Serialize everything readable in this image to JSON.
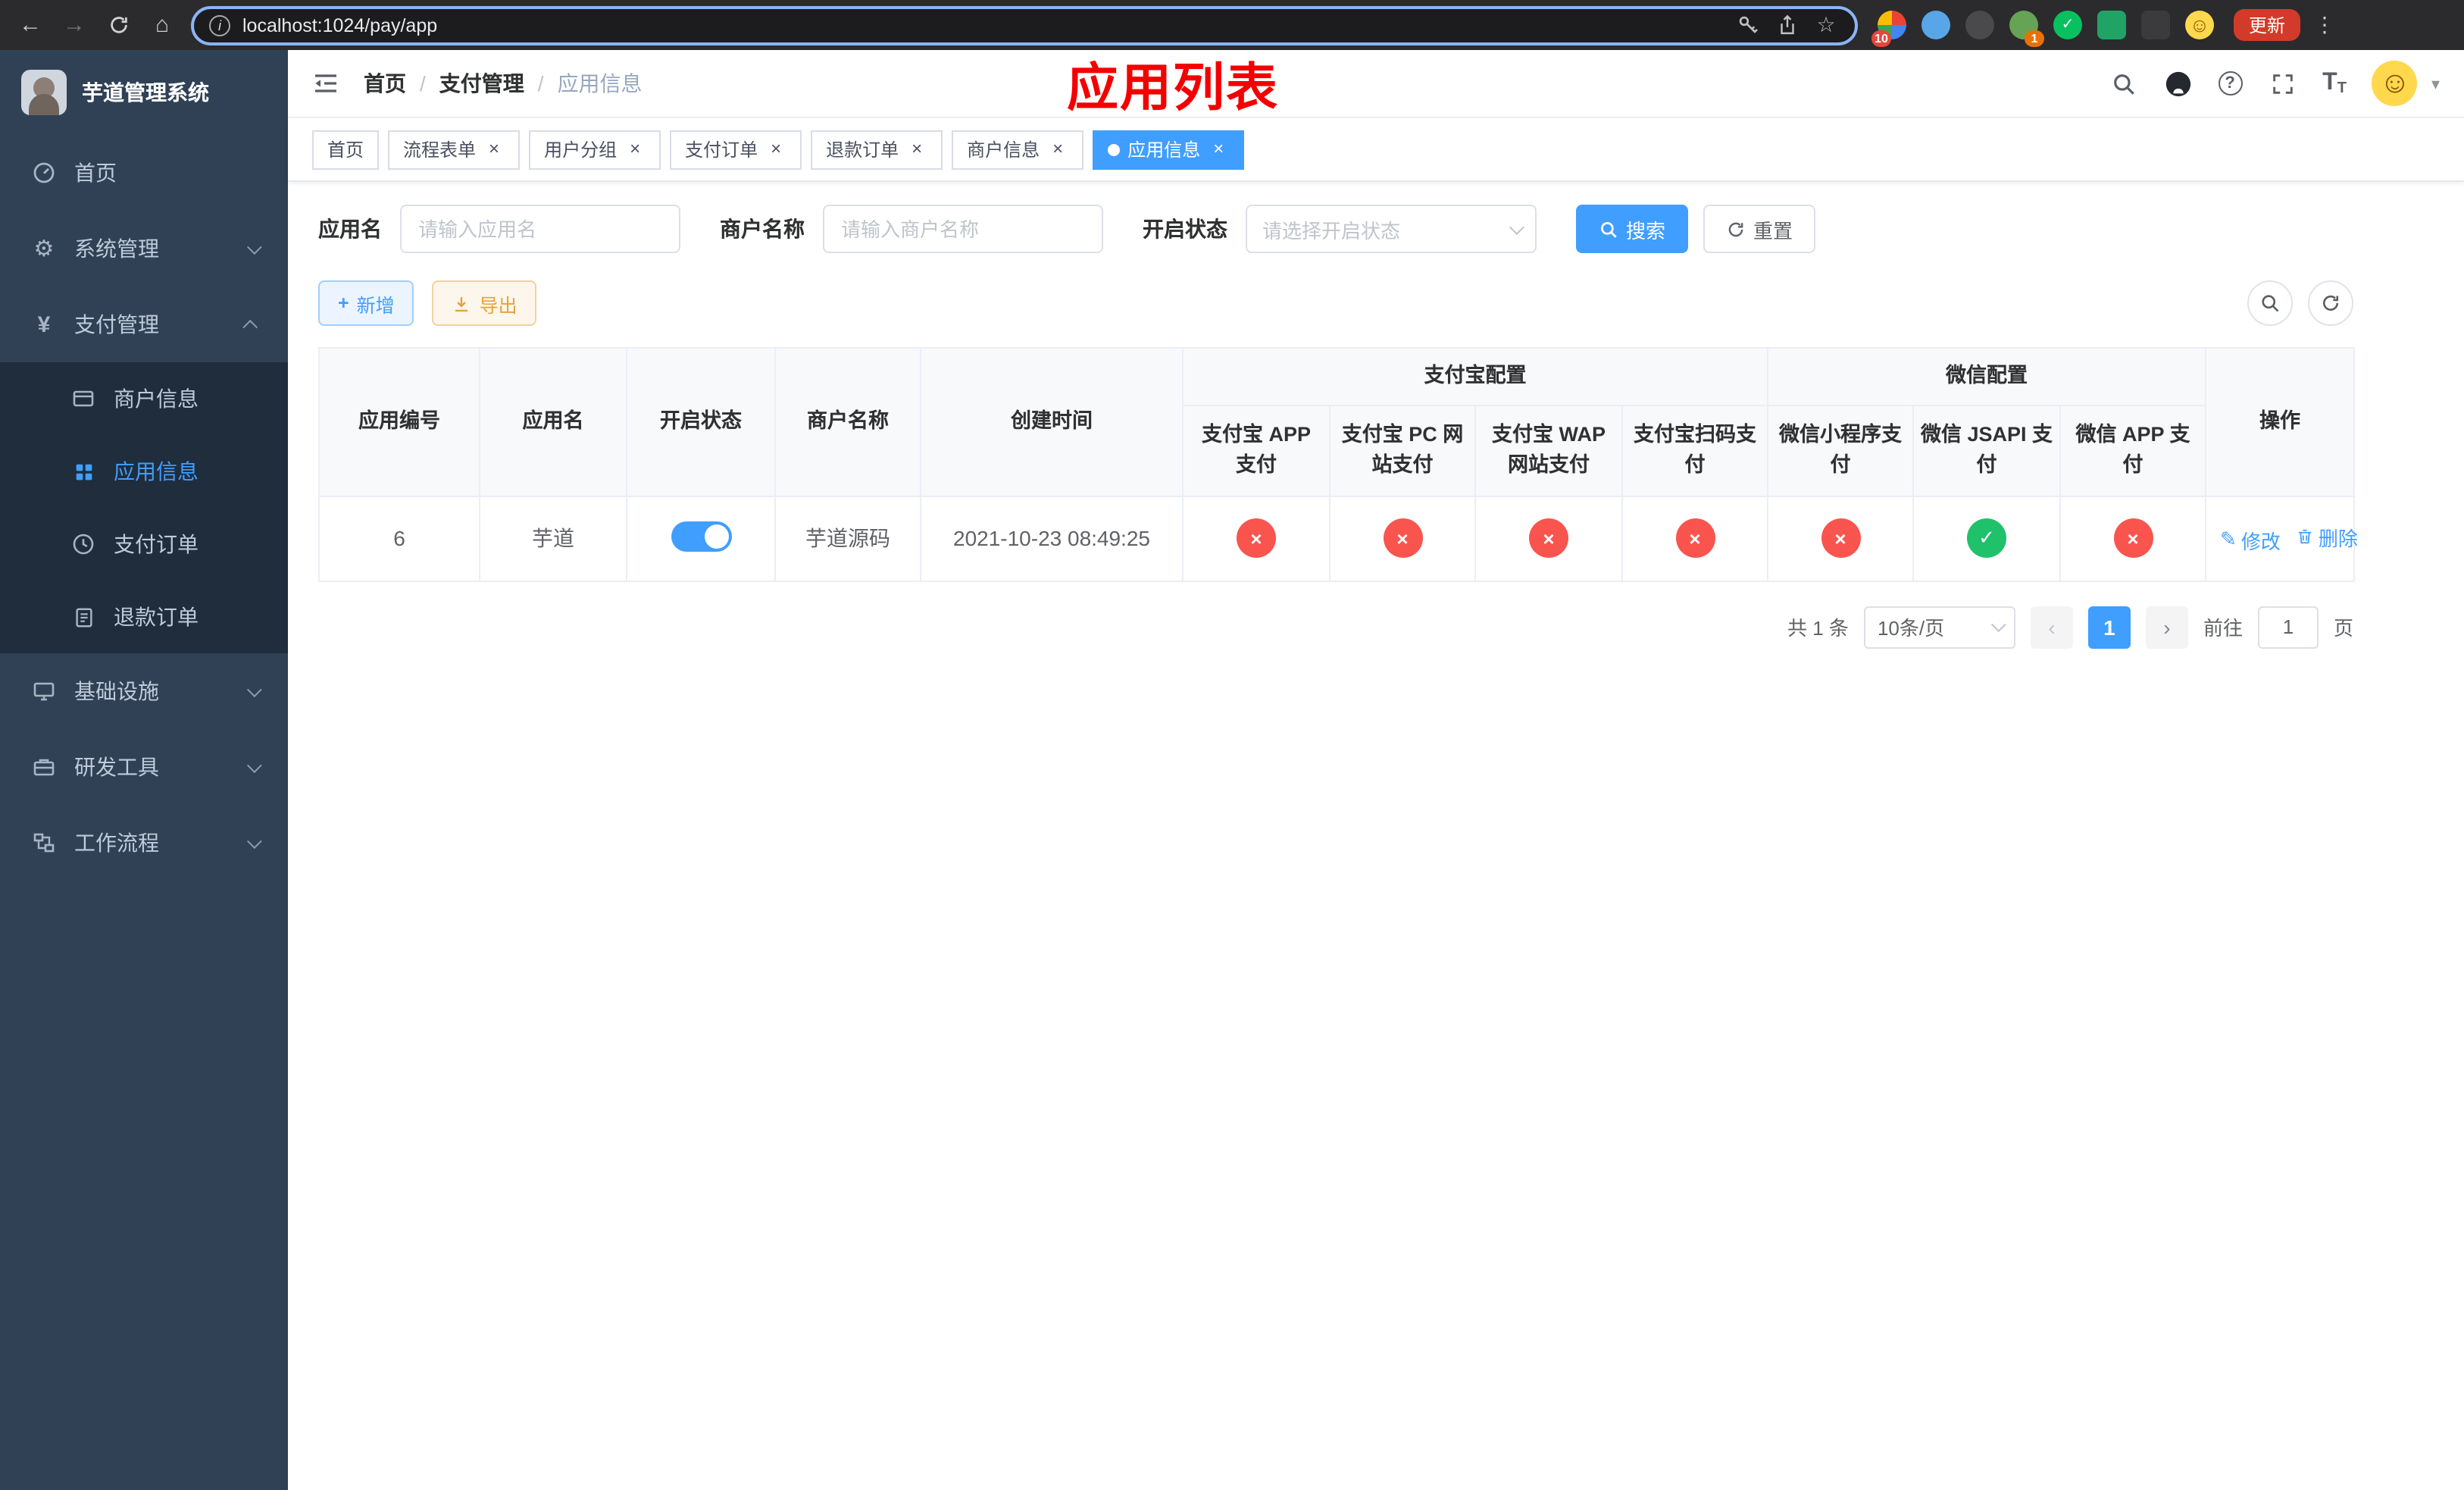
{
  "colors": {
    "accent": "#409eff",
    "success": "#1fc16b",
    "danger": "#f9544e",
    "warning": "#e6a23c",
    "sidebar_bg": "#304156",
    "submenu_bg": "#1f2d3d",
    "annotation_red": "#f50000",
    "tab_active_bg": "#409eff"
  },
  "icons": {
    "back": "←",
    "forward": "→",
    "home": "⌂",
    "info": "i",
    "star": "☆",
    "dots": "⋮",
    "gear": "⚙",
    "yen": "¥",
    "question": "?",
    "font": "T",
    "smiley": "☺",
    "caret": "▾",
    "close": "×",
    "check": "✓",
    "plus": "+",
    "edit": "✎",
    "prev": "‹",
    "next": "›"
  },
  "browser": {
    "url": "localhost:1024/pay/app",
    "update_button": "更新",
    "badge_extensions": "10",
    "badge_avatar": "1"
  },
  "sidebar": {
    "app_title": "芋道管理系统",
    "items": {
      "home": "首页",
      "system": "系统管理",
      "payment": "支付管理",
      "merchant_info": "商户信息",
      "app_info": "应用信息",
      "pay_order": "支付订单",
      "refund_order": "退款订单",
      "infrastructure": "基础设施",
      "dev_tools": "研发工具",
      "workflow": "工作流程"
    }
  },
  "header": {
    "breadcrumb": [
      "首页",
      "支付管理",
      "应用信息"
    ],
    "separator": "/",
    "annotation": "应用列表"
  },
  "tabs": [
    {
      "label": "首页",
      "closable": false,
      "active": false
    },
    {
      "label": "流程表单",
      "closable": true,
      "active": false
    },
    {
      "label": "用户分组",
      "closable": true,
      "active": false
    },
    {
      "label": "支付订单",
      "closable": true,
      "active": false
    },
    {
      "label": "退款订单",
      "closable": true,
      "active": false
    },
    {
      "label": "商户信息",
      "closable": true,
      "active": false
    },
    {
      "label": "应用信息",
      "closable": true,
      "active": true
    }
  ],
  "filters": {
    "app_name_label": "应用名",
    "app_name_placeholder": "请输入应用名",
    "merchant_label": "商户名称",
    "merchant_placeholder": "请输入商户名称",
    "status_label": "开启状态",
    "status_placeholder": "请选择开启状态",
    "search_button": "搜索",
    "reset_button": "重置"
  },
  "toolbar": {
    "add_button": "新增",
    "export_button": "导出"
  },
  "table": {
    "columns": {
      "app_id": "应用编号",
      "app_name": "应用名",
      "status": "开启状态",
      "merchant": "商户名称",
      "created": "创建时间",
      "alipay_group": "支付宝配置",
      "alipay_app": "支付宝 APP 支付",
      "alipay_pc": "支付宝 PC 网站支付",
      "alipay_wap": "支付宝 WAP 网站支付",
      "alipay_qr": "支付宝扫码支付",
      "wechat_group": "微信配置",
      "wechat_lite": "微信小程序支付",
      "wechat_jsapi": "微信 JSAPI 支付",
      "wechat_app": "微信 APP 支付",
      "actions": "操作"
    },
    "actions": {
      "edit": "修改",
      "delete": "删除"
    },
    "rows": [
      {
        "app_id": "6",
        "app_name": "芋道",
        "status_on": true,
        "merchant": "芋道源码",
        "created": "2021-10-23 08:49:25",
        "channels": {
          "alipay_app": false,
          "alipay_pc": false,
          "alipay_wap": false,
          "alipay_qr": false,
          "wechat_lite": false,
          "wechat_jsapi": true,
          "wechat_app": false
        }
      }
    ]
  },
  "pagination": {
    "total_label": "共 1 条",
    "page_size": "10条/页",
    "current_page": "1",
    "goto_label": "前往",
    "goto_value": "1",
    "page_unit": "页"
  }
}
